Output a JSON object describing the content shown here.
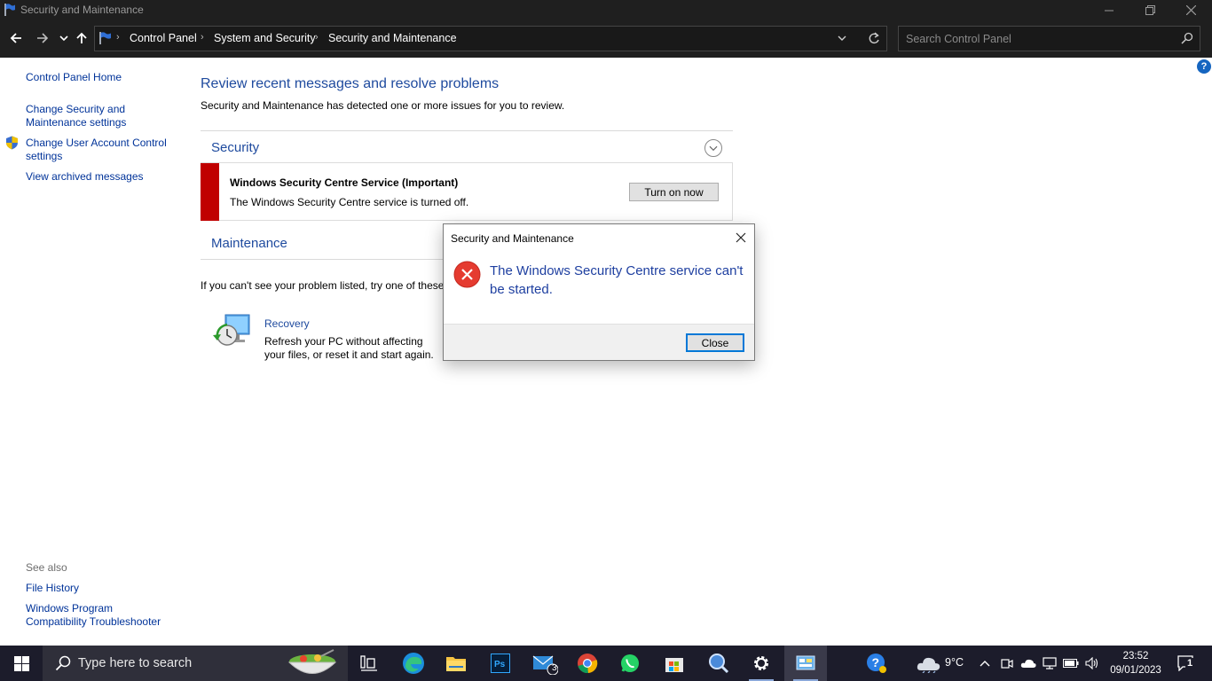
{
  "window": {
    "title": "Security and Maintenance"
  },
  "breadcrumb": {
    "items": [
      "Control Panel",
      "System and Security",
      "Security and Maintenance"
    ]
  },
  "search": {
    "placeholder": "Search Control Panel"
  },
  "sidebar": {
    "home": "Control Panel Home",
    "links": [
      "Change Security and Maintenance settings",
      "Change User Account Control settings",
      "View archived messages"
    ],
    "see_also_title": "See also",
    "see_also": [
      "File History",
      "Windows Program Compatibility Troubleshooter"
    ]
  },
  "main": {
    "heading": "Review recent messages and resolve problems",
    "description": "Security and Maintenance has detected one or more issues for you to review.",
    "security_title": "Security",
    "alert": {
      "title": "Windows Security Centre Service  (Important)",
      "description": "The Windows Security Centre service is turned off.",
      "button": "Turn on now",
      "color": "#c00000"
    },
    "maintenance_title": "Maintenance",
    "hint": "If you can't see your problem listed, try one of these",
    "recovery": {
      "title": "Recovery",
      "description": "Refresh your PC without affecting your files, or reset it and start again."
    }
  },
  "dialog": {
    "title": "Security and Maintenance",
    "message": "The Windows Security Centre service can't be started.",
    "close_button": "Close"
  },
  "taskbar": {
    "search_placeholder": "Type here to search",
    "mail_badge": "3",
    "temperature": "9°C",
    "time": "23:52",
    "date": "09/01/2023",
    "notification_count": "1"
  }
}
